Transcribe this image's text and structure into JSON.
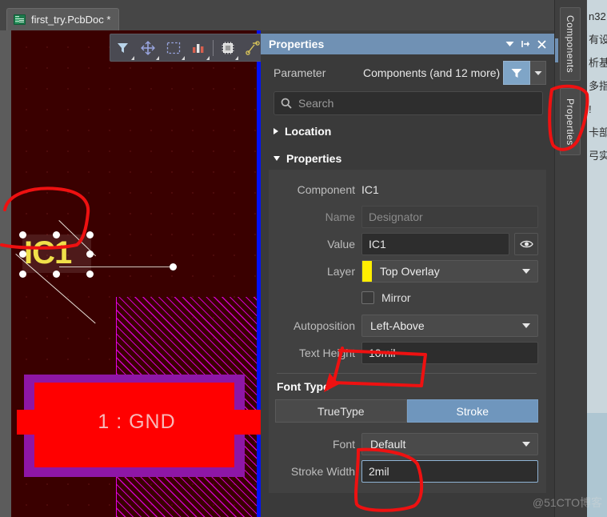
{
  "window": {
    "document_tab": {
      "label": "first_try.PcbDoc *",
      "icon": "pcb-document-icon"
    }
  },
  "mini_toolbar": {
    "buttons": [
      {
        "name": "filter-tool",
        "icon": "funnel-icon"
      },
      {
        "name": "crosshair-tool",
        "icon": "crosshair-icon"
      },
      {
        "name": "area-select-tool",
        "icon": "marquee-select-icon"
      },
      {
        "name": "layer-stack-tool",
        "icon": "bar-chart-icon"
      },
      {
        "name": "component-tool",
        "icon": "chip-icon"
      },
      {
        "name": "route-tool",
        "icon": "route-path-icon"
      }
    ]
  },
  "panel": {
    "title": "Properties",
    "title_buttons": [
      {
        "name": "panel-menu-button",
        "icon": "chevron-down-icon",
        "glyph": "▼"
      },
      {
        "name": "panel-pin-button",
        "icon": "pin-icon",
        "glyph": "⊣"
      },
      {
        "name": "panel-close-button",
        "icon": "close-icon",
        "glyph": "✕"
      }
    ],
    "parameter": {
      "label": "Parameter",
      "value": "Components (and 12 more)",
      "filter_icon": "funnel-icon",
      "dropdown_icon": "chevron-down-icon"
    },
    "search": {
      "placeholder": "Search",
      "value": "",
      "icon": "search-icon"
    },
    "sections": [
      {
        "name": "location",
        "label": "Location",
        "expanded": false
      },
      {
        "name": "properties",
        "label": "Properties",
        "expanded": true
      }
    ],
    "fields": {
      "component": {
        "label": "Component",
        "value": "IC1"
      },
      "name": {
        "label": "Name",
        "placeholder": "Designator",
        "value": "",
        "disabled": true
      },
      "value": {
        "label": "Value",
        "value": "IC1",
        "eye_icon": "eye-icon"
      },
      "layer": {
        "label": "Layer",
        "value": "Top Overlay",
        "swatch_color": "#ffee00"
      },
      "mirror": {
        "label": "Mirror",
        "checked": false
      },
      "autoposition": {
        "label": "Autoposition",
        "value": "Left-Above"
      },
      "text_height": {
        "label": "Text Height",
        "value": "10mil"
      },
      "font_type": {
        "label": "Font Type",
        "options": [
          "TrueType",
          "Stroke"
        ],
        "selected": "Stroke"
      },
      "font": {
        "label": "Font",
        "value": "Default"
      },
      "stroke_width": {
        "label": "Stroke Width",
        "value": "2mil",
        "focused": true
      }
    }
  },
  "rail": {
    "tabs": [
      {
        "name": "rail-tab-components",
        "label": "Components",
        "active": false
      },
      {
        "name": "rail-tab-properties",
        "label": "Properties",
        "active": true
      }
    ]
  },
  "canvas": {
    "designator": {
      "text": "IC1",
      "color": "#f0e04a",
      "selected": true
    },
    "pad": {
      "label": "1 : GND",
      "copper_color": "#ff0000",
      "outline_color": "#8e16a6"
    },
    "board_edge_color": "#0010ff",
    "pour_color": "#e600e6",
    "background_color": "#3a0000"
  },
  "sliver": {
    "lines": [
      "n32",
      "有设",
      "析基",
      "多指",
      "!",
      "卡部",
      "弓实"
    ]
  },
  "annotations": {
    "ink_color": "#ee1111",
    "marks": [
      {
        "name": "ink-circle-designator",
        "target": "IC1 designator on canvas"
      },
      {
        "name": "ink-arrow-text-height",
        "target": "Text Height field"
      },
      {
        "name": "ink-circle-stroke-width",
        "target": "Stroke Width field"
      },
      {
        "name": "ink-circle-properties-tab",
        "target": "Properties vertical tab"
      }
    ]
  },
  "watermark": {
    "text": "@51CTO博客"
  }
}
